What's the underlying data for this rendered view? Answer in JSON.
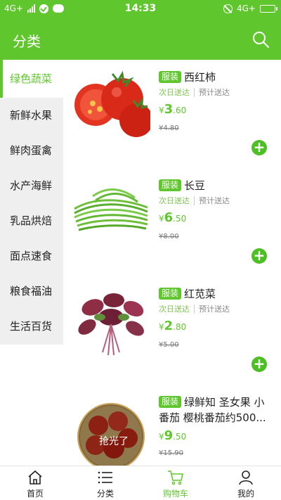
{
  "status_bar": {
    "network_left": "4G+",
    "time": "14:33",
    "network_right": "4G+"
  },
  "header": {
    "title": "分类",
    "search_icon": "search-icon"
  },
  "sidebar": {
    "items": [
      {
        "label": "绿色蔬菜",
        "active": true
      },
      {
        "label": "新鲜水果",
        "active": false
      },
      {
        "label": "鲜肉蛋禽",
        "active": false
      },
      {
        "label": "水产海鲜",
        "active": false
      },
      {
        "label": "乳品烘焙",
        "active": false
      },
      {
        "label": "面点速食",
        "active": false
      },
      {
        "label": "粮食福油",
        "active": false
      },
      {
        "label": "生活百货",
        "active": false
      }
    ]
  },
  "products": [
    {
      "tag": "服装",
      "name": "西红柿",
      "next_day": "次日送达",
      "preorder": "预计送达",
      "currency": "¥",
      "price_int": "3",
      "price_dec": ".60",
      "old_price": "¥4.80"
    },
    {
      "tag": "服装",
      "name": "长豆",
      "next_day": "次日送达",
      "preorder": "预计送达",
      "currency": "¥",
      "price_int": "6",
      "price_dec": ".50",
      "old_price": "¥8.00"
    },
    {
      "tag": "服装",
      "name": "红苋菜",
      "next_day": "次日送达",
      "preorder": "预计送达",
      "currency": "¥",
      "price_int": "2",
      "price_dec": ".80",
      "old_price": "¥5.00"
    },
    {
      "tag": "服装",
      "name": "绿鲜知 圣女果 小番茄 樱桃番茄约500...",
      "currency": "¥",
      "price_int": "9",
      "price_dec": ".50",
      "old_price": "¥15.90",
      "sold_out": "抢光了"
    }
  ],
  "bottom_nav": {
    "items": [
      {
        "label": "首页",
        "icon": "home-icon"
      },
      {
        "label": "分类",
        "icon": "list-icon"
      },
      {
        "label": "购物车",
        "icon": "cart-icon",
        "active": true
      },
      {
        "label": "我的",
        "icon": "user-icon"
      }
    ]
  },
  "colors": {
    "accent": "#5fc72d",
    "sidebar_bg": "#efefef"
  }
}
